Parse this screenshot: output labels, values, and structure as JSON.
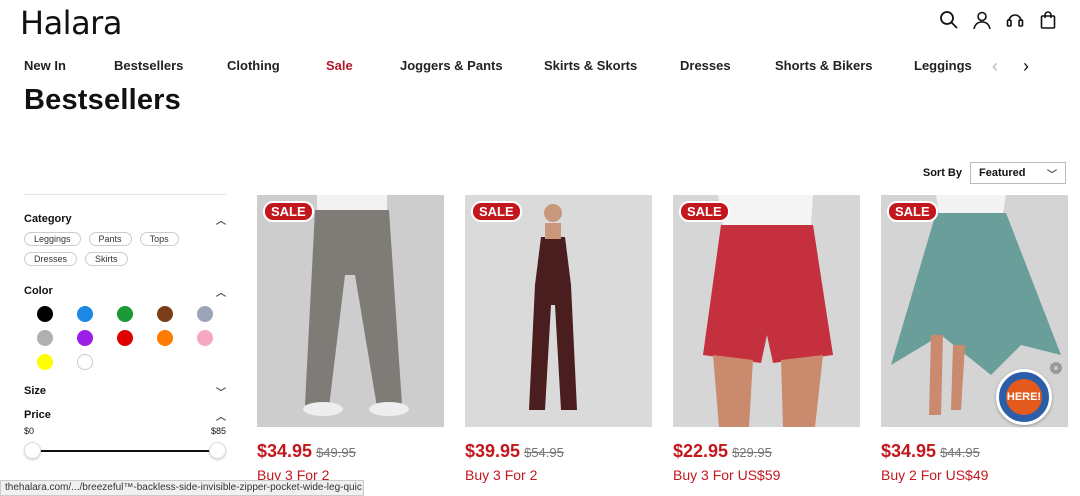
{
  "brand": {
    "logo": "Halara"
  },
  "header_icons": [
    "search-icon",
    "account-icon",
    "support-icon",
    "bag-icon"
  ],
  "nav": {
    "items": [
      "New In",
      "Bestsellers",
      "Clothing",
      "Sale",
      "Joggers & Pants",
      "Skirts & Skorts",
      "Dresses",
      "Shorts & Bikers",
      "Leggings"
    ],
    "prev_icon": "‹",
    "next_icon": "›"
  },
  "page_title": "Bestsellers",
  "sort": {
    "label": "Sort By",
    "value": "Featured"
  },
  "filters": {
    "category": {
      "label": "Category",
      "chips": [
        "Leggings",
        "Pants",
        "Tops",
        "Dresses",
        "Skirts"
      ]
    },
    "color": {
      "label": "Color",
      "swatches": [
        "#000000",
        "#1e88e5",
        "#1a9a34",
        "#7a3f1a",
        "#9aa6b8",
        "#b0b0b0",
        "#9b1de6",
        "#e00000",
        "#ff7a00",
        "#f6a6c3",
        "#ffff00",
        "#ffffff"
      ]
    },
    "size": {
      "label": "Size"
    },
    "price": {
      "label": "Price",
      "min": "$0",
      "max": "$85"
    }
  },
  "products": [
    {
      "badge": "SALE",
      "price": "$34.95",
      "was": "$49.95",
      "promo": "Buy 3 For 2",
      "bg": "#cfcfcf"
    },
    {
      "badge": "SALE",
      "price": "$39.95",
      "was": "$54.95",
      "promo": "Buy 3 For 2",
      "bg": "#dcdcdc"
    },
    {
      "badge": "SALE",
      "price": "$22.95",
      "was": "$29.95",
      "promo": "Buy 3 For US$59",
      "bg": "#d9d9d9"
    },
    {
      "badge": "SALE",
      "price": "$34.95",
      "was": "$44.95",
      "promo": "Buy 2 For US$49",
      "bg": "#d8d8d8"
    }
  ],
  "gift_widget": {
    "text": "HERE!",
    "close": "×"
  },
  "status_bar": "thehalara.com/.../breezeful™-backless-side-invisible-zipper-pocket-wide-leg-quic..."
}
